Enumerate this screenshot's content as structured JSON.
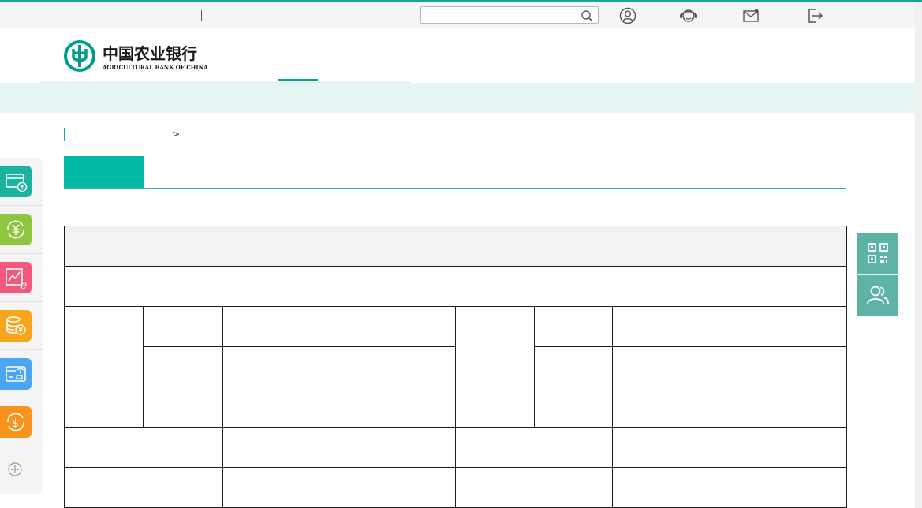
{
  "colors": {
    "brand": "#00a49a",
    "tab_active": "#00b8a5",
    "band": "#e4f5f3",
    "float_panel": "#5db3a5"
  },
  "topbar": {
    "search": {
      "value": "",
      "placeholder": ""
    },
    "icons": [
      "user-icon",
      "customer-service-icon",
      "mail-icon",
      "logout-icon"
    ]
  },
  "header": {
    "logo_cn": "中国农业银行",
    "logo_en": "AGRICULTURAL BANK OF CHINA"
  },
  "breadcrumb": {
    "separator": ">"
  },
  "sidebar": {
    "items": [
      "card-icon",
      "yuan-exchange-icon",
      "e-chart-icon",
      "coin-stack-icon",
      "transfer-card-icon",
      "dollar-exchange-icon"
    ],
    "tile_colors": [
      "#19b3a0",
      "#8ec63f",
      "#f4587a",
      "#f7a51c",
      "#4aa6f2",
      "#f7941d"
    ],
    "add_icon": "plus-circle-icon"
  },
  "float_panel": {
    "items": [
      "qr-code-icon",
      "people-icon"
    ]
  }
}
